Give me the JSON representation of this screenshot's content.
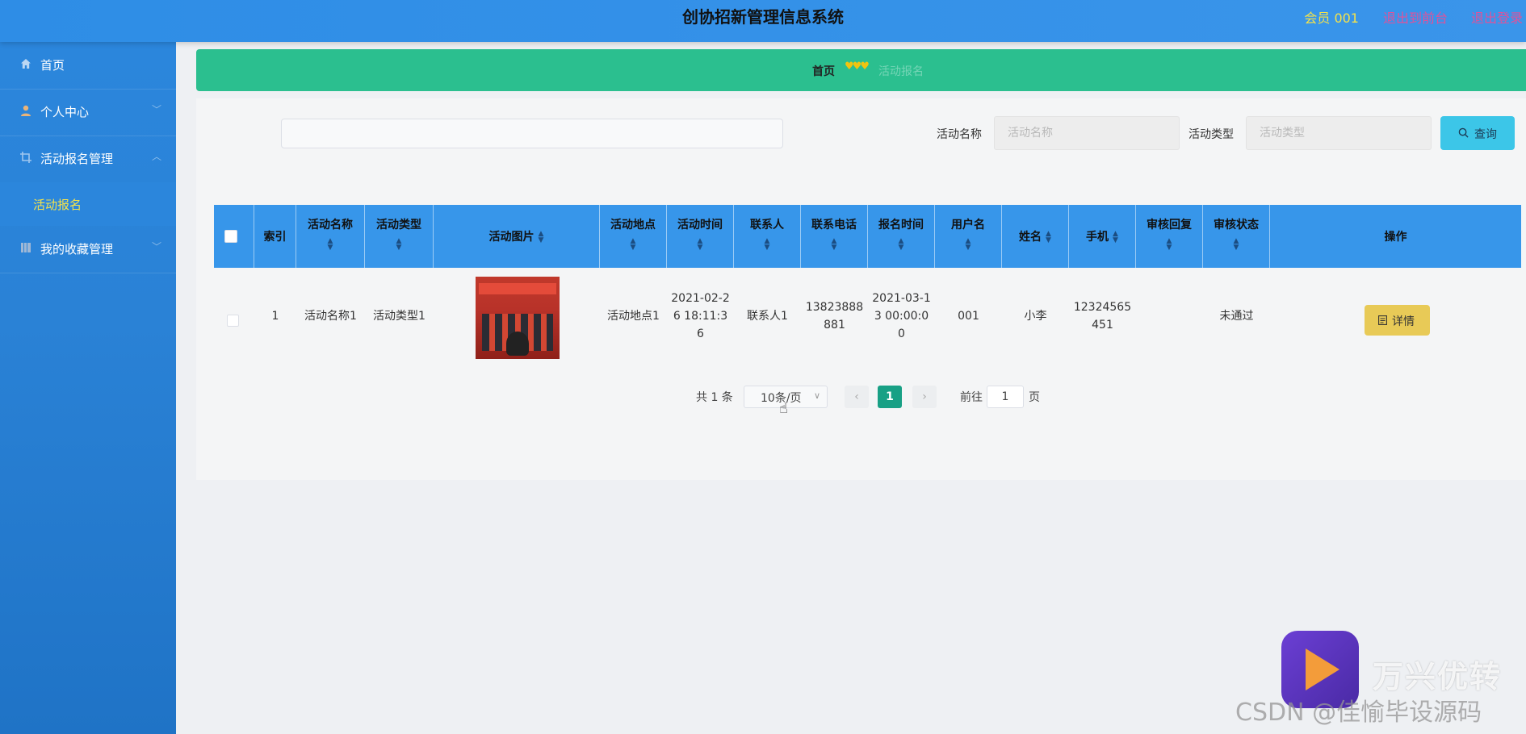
{
  "app": {
    "title": "创协招新管理信息系统",
    "member_label": "会员 001",
    "link_back": "退出到前台",
    "link_logout": "退出登录"
  },
  "sidebar": {
    "items": [
      {
        "label": "首页",
        "icon": "home-icon"
      },
      {
        "label": "个人中心",
        "icon": "user-icon"
      },
      {
        "label": "活动报名管理",
        "icon": "crop-icon"
      },
      {
        "label": "我的收藏管理",
        "icon": "book-icon"
      }
    ],
    "submenu_active": "活动报名"
  },
  "breadcrumb": {
    "home": "首页",
    "separator": "♥♥♥",
    "current": "活动报名"
  },
  "search": {
    "name_label": "活动名称",
    "name_placeholder": "活动名称",
    "type_label": "活动类型",
    "type_placeholder": "活动类型",
    "button_label": "查询"
  },
  "table": {
    "headers": [
      "索引",
      "活动名称",
      "活动类型",
      "活动图片",
      "活动地点",
      "活动时间",
      "联系人",
      "联系电话",
      "报名时间",
      "用户名",
      "姓名",
      "手机",
      "审核回复",
      "审核状态",
      "操作"
    ],
    "sort_glyph": "▲▼",
    "rows": [
      {
        "index": "1",
        "name": "活动名称1",
        "type": "活动类型1",
        "location": "活动地点1",
        "time": "2021-02-26 18:11:36",
        "contact": "联系人1",
        "phone": "13823888881",
        "signup_time": "2021-03-13 00:00:00",
        "username": "001",
        "real_name": "小李",
        "mobile": "12324565451",
        "review_reply": "",
        "review_status": "未通过",
        "action_label": "详情"
      }
    ]
  },
  "pagination": {
    "total": "共 1 条",
    "page_size": "10条/页",
    "prev": "‹",
    "current_page": "1",
    "next": "›",
    "goto_label": "前往",
    "goto_value": "1",
    "goto_unit": "页"
  },
  "watermark": {
    "brand": "万兴优转",
    "csdn": "CSDN @佳愉毕设源码"
  },
  "colors": {
    "header_bg": "#3090e8",
    "sidebar_bg": "#2a82d6",
    "breadcrumb_bg": "#2bbf8f",
    "table_header_bg": "#3796ea",
    "search_button_bg": "#3cc6e8",
    "detail_button_bg": "#e8ca57",
    "pager_active_bg": "#18a085",
    "accent_yellow": "#f5e34a",
    "link_pink": "#e0529a"
  }
}
